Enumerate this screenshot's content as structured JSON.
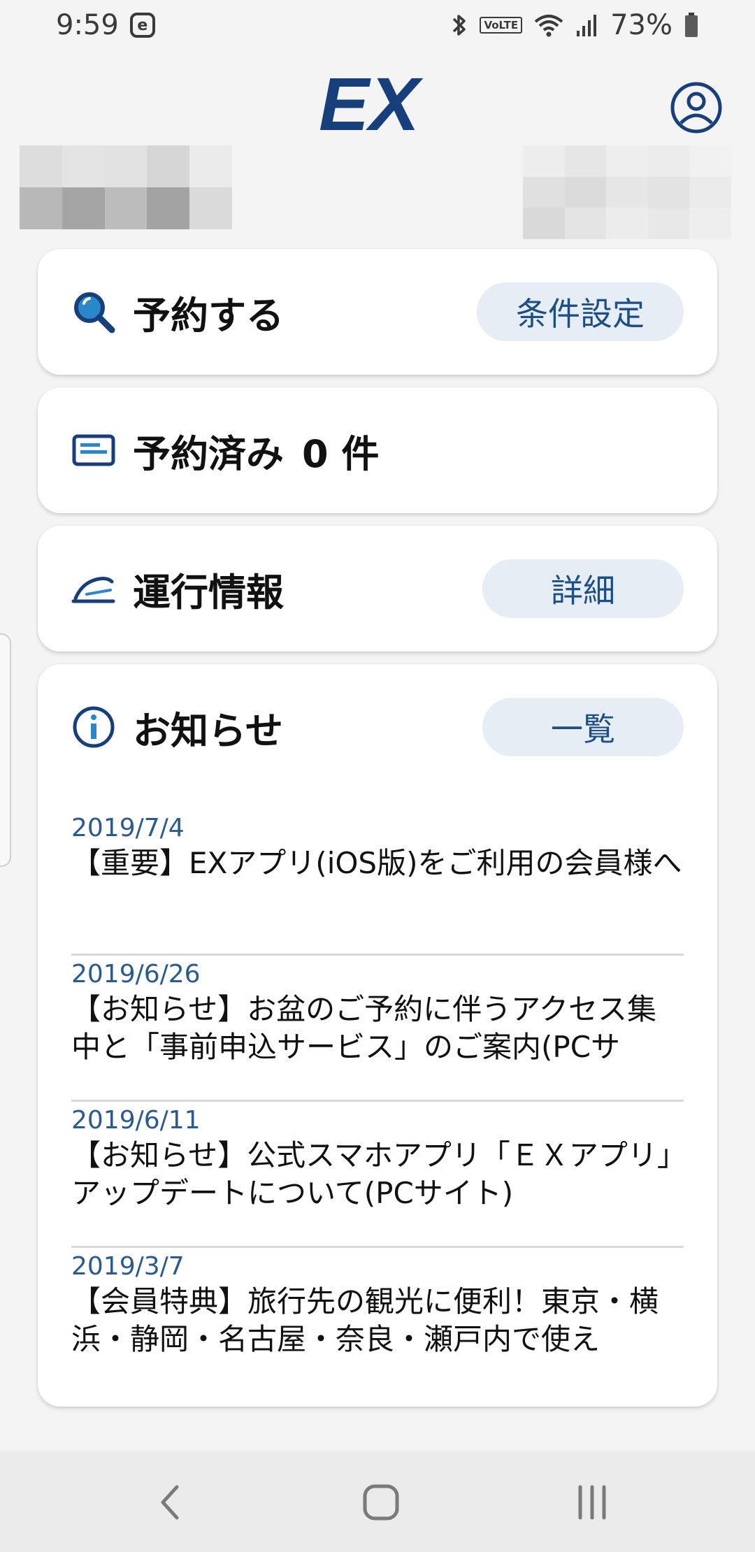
{
  "status_bar": {
    "time": "9:59",
    "notification_icon": "e-circle-icon",
    "volte": "VoLTE",
    "battery": "73%"
  },
  "header": {
    "logo_text": "EX",
    "logo_color": "#163f7c",
    "account_icon": "account-circle-icon"
  },
  "cards": {
    "reserve": {
      "icon": "search-icon",
      "title": "予約する",
      "button": "条件設定"
    },
    "booked": {
      "icon": "ticket-card-icon",
      "title": "予約済み",
      "count": "0 件"
    },
    "operation": {
      "icon": "shinkansen-icon",
      "title": "運行情報",
      "button": "詳細"
    },
    "news": {
      "icon": "info-icon",
      "title": "お知らせ",
      "button": "一覧",
      "items": [
        {
          "date": "2019/7/4",
          "text": "【重要】EXアプリ(iOS版)をご利用の会員様へ"
        },
        {
          "date": "2019/6/26",
          "text": "【お知らせ】お盆のご予約に伴うアクセス集中と「事前申込サービス」のご案内(PCサ"
        },
        {
          "date": "2019/6/11",
          "text": "【お知らせ】公式スマホアプリ「ＥＸアプリ」アップデートについて(PCサイト)"
        },
        {
          "date": "2019/3/7",
          "text": "【会員特典】旅行先の観光に便利！東京・横浜・静岡・名古屋・奈良・瀬戸内で使え"
        }
      ]
    }
  },
  "colors": {
    "accent": "#1d4e86",
    "pill_bg": "#e6edf4",
    "date": "#2b5a8e"
  },
  "nav": {
    "back_icon": "back-chevron-icon",
    "home_icon": "home-icon",
    "recents_icon": "recents-icon"
  }
}
